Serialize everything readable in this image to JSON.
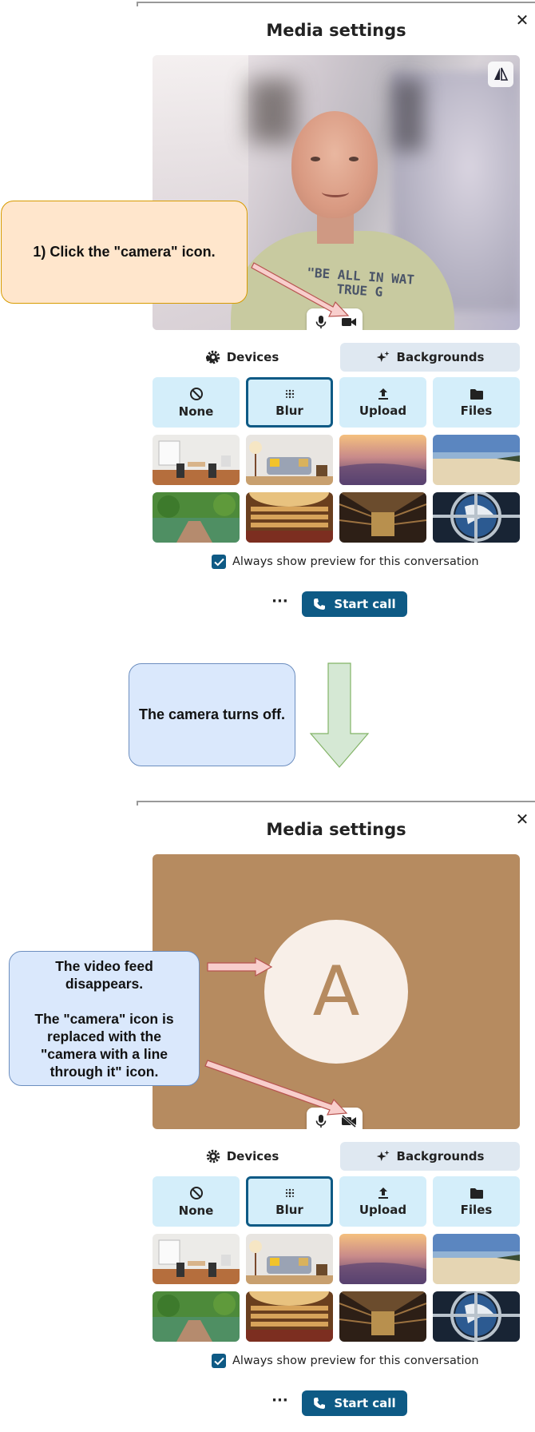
{
  "panel": {
    "title": "Media settings",
    "close_icon": "close-icon",
    "mirror_icon": "mirror-flip-icon",
    "shirt_text": "\"BE ALL IN WAT\nTRUE G",
    "avatar_letter": "A",
    "tabs": [
      {
        "label": "Devices",
        "icon": "gear-icon"
      },
      {
        "label": "Backgrounds",
        "icon": "sparkles-icon"
      }
    ],
    "background_buttons": [
      {
        "label": "None",
        "icon": "no-symbol-icon"
      },
      {
        "label": "Blur",
        "icon": "blur-icon"
      },
      {
        "label": "Upload",
        "icon": "upload-icon"
      },
      {
        "label": "Files",
        "icon": "folder-icon"
      }
    ],
    "preview_checkbox_label": "Always show preview for this conversation",
    "more_label": "···",
    "start_call_label": "Start call"
  },
  "callouts": {
    "step1": "1) Click the \"camera\" icon.",
    "camera_off": "The camera turns off.",
    "result": "The video feed disappears.\n\nThe \"camera\" icon is replaced with the \"camera with a line through it\" icon."
  },
  "colors": {
    "accent": "#0e5a85",
    "bg_button": "#d4eefa",
    "tab_active": "#dfe8f1",
    "video_off": "#b68b60",
    "avatar_bg": "#f8efe8",
    "callout_orange": "#ffe6cc",
    "callout_blue": "#dae8fc",
    "arrow_pink": "#f8cecc",
    "arrow_green": "#d5e8d4"
  }
}
